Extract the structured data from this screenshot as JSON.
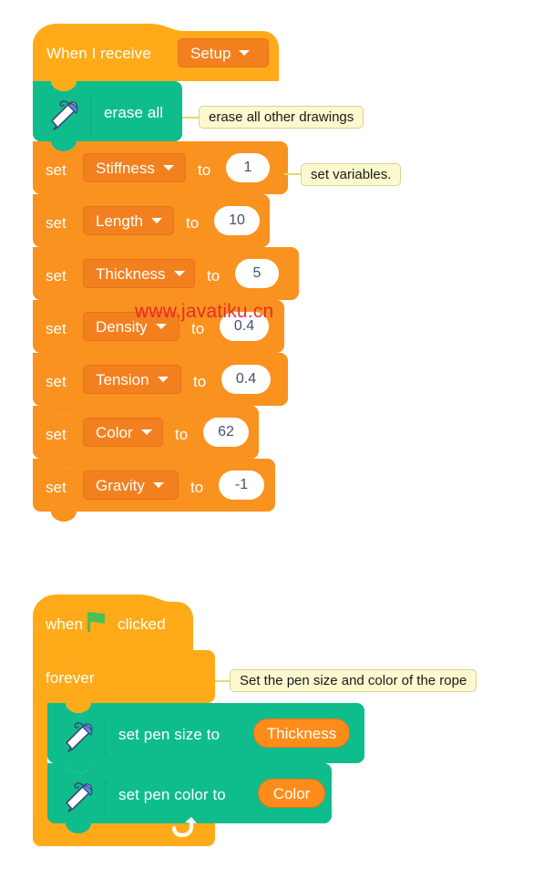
{
  "page": {
    "title": "Scratch Blocks Editor Workspace",
    "background": "#ffffff",
    "watermark": "www.javatiku.cn"
  },
  "palette": {
    "events_hat": "#ffab19",
    "events_hat_dark": "#cf8b17",
    "control": "#ffab19",
    "variables": "#f9921f",
    "variables_dark": "#db6e00",
    "pen_green": "#0fbd8c",
    "pen_green_dark": "#0b8e69",
    "reporter_orange": "#ff8c1a",
    "comment_bg": "#fcf9cf",
    "comment_border": "#d8d296",
    "comment_line": "#e6d96b",
    "input_white": "#ffffff",
    "input_text": "#45506b",
    "watermark_red": "#e8232a"
  },
  "scripts": [
    {
      "id": "setup-script",
      "name": "setup-broadcast-script",
      "hat": {
        "name": "when-i-receive-block",
        "label": "When I receive",
        "dropdown": {
          "name": "broadcast-dropdown",
          "value": "Setup",
          "icon": "chevron-down-icon"
        }
      },
      "blocks": [
        {
          "name": "erase-all-block",
          "type": "pen",
          "icon": "pen-icon",
          "label": "erase all"
        },
        {
          "name": "set-stiffness-block",
          "type": "set-variable",
          "prefix": "set",
          "variable": "Stiffness",
          "connector": "to",
          "value": "1",
          "icon": "chevron-down-icon"
        },
        {
          "name": "set-length-block",
          "type": "set-variable",
          "prefix": "set",
          "variable": "Length",
          "connector": "to",
          "value": "10",
          "icon": "chevron-down-icon"
        },
        {
          "name": "set-thickness-block",
          "type": "set-variable",
          "prefix": "set",
          "variable": "Thickness",
          "connector": "to",
          "value": "5",
          "icon": "chevron-down-icon"
        },
        {
          "name": "set-density-block",
          "type": "set-variable",
          "prefix": "set",
          "variable": "Density",
          "connector": "to",
          "value": "0.4",
          "icon": "chevron-down-icon"
        },
        {
          "name": "set-tension-block",
          "type": "set-variable",
          "prefix": "set",
          "variable": "Tension",
          "connector": "to",
          "value": "0.4",
          "icon": "chevron-down-icon"
        },
        {
          "name": "set-color-block",
          "type": "set-variable",
          "prefix": "set",
          "variable": "Color",
          "connector": "to",
          "value": "62",
          "icon": "chevron-down-icon"
        },
        {
          "name": "set-gravity-block",
          "type": "set-variable",
          "prefix": "set",
          "variable": "Gravity",
          "connector": "to",
          "value": "-1",
          "icon": "chevron-down-icon"
        }
      ],
      "comments": [
        {
          "name": "comment-erase-all",
          "text": "erase all other drawings"
        },
        {
          "name": "comment-set-variables",
          "text": "set variables."
        }
      ]
    },
    {
      "id": "flag-script",
      "name": "green-flag-script",
      "hat": {
        "name": "when-flag-clicked-block",
        "label_before": "when",
        "icon": "green-flag-icon",
        "label_after": "clicked"
      },
      "loop": {
        "name": "forever-block",
        "label": "forever",
        "icon": "loop-arrow-icon"
      },
      "blocks": [
        {
          "name": "set-pen-size-block",
          "type": "pen",
          "icon": "pen-icon",
          "label": "set pen size to",
          "argument": {
            "name": "thickness-variable-reporter",
            "label": "Thickness"
          }
        },
        {
          "name": "set-pen-color-block",
          "type": "pen",
          "icon": "pen-icon",
          "label": "set pen color to",
          "argument": {
            "name": "color-variable-reporter",
            "label": "Color"
          }
        }
      ],
      "comments": [
        {
          "name": "comment-pen-settings",
          "text": "Set the pen size and color of the rope"
        }
      ]
    }
  ]
}
